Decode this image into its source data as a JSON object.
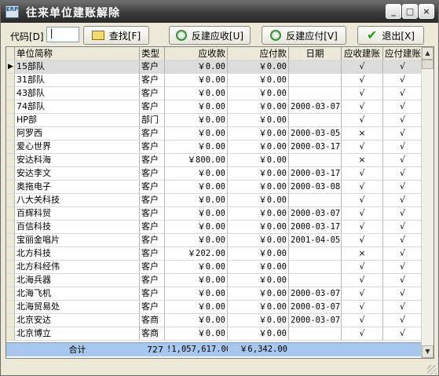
{
  "window": {
    "icon_text": "ERP",
    "title": "往来单位建账解除",
    "minimize_label": "_",
    "maximize_label": "□",
    "close_label": "×"
  },
  "toolbar": {
    "code_label": "代码[D]",
    "code_value": "|",
    "find_label": "查找[F]",
    "reverse_receivable_label": "反建应收[U]",
    "reverse_payable_label": "反建应付[V]",
    "exit_label": "退出[X]"
  },
  "table": {
    "headers": {
      "name": "单位简称",
      "type": "类型",
      "receivable": "应收款",
      "payable": "应付款",
      "date": "日期",
      "recv_created": "应收建账",
      "pay_created": "应付建账"
    },
    "rows": [
      {
        "name": "15部队",
        "type": "客户",
        "receivable": "￥0.00",
        "payable": "￥0.00",
        "date": "",
        "rc": "√",
        "pc": "√"
      },
      {
        "name": "31部队",
        "type": "客户",
        "receivable": "￥0.00",
        "payable": "￥0.00",
        "date": "",
        "rc": "√",
        "pc": "√"
      },
      {
        "name": "43部队",
        "type": "客户",
        "receivable": "￥0.00",
        "payable": "￥0.00",
        "date": "",
        "rc": "√",
        "pc": "√"
      },
      {
        "name": "74部队",
        "type": "客户",
        "receivable": "￥0.00",
        "payable": "￥0.00",
        "date": "2000-03-07",
        "rc": "√",
        "pc": "√"
      },
      {
        "name": "HP部",
        "type": "部门",
        "receivable": "￥0.00",
        "payable": "￥0.00",
        "date": "",
        "rc": "√",
        "pc": "√"
      },
      {
        "name": "阿罗西",
        "type": "客户",
        "receivable": "￥0.00",
        "payable": "￥0.00",
        "date": "2000-03-05",
        "rc": "×",
        "pc": "√"
      },
      {
        "name": "爱心世界",
        "type": "客户",
        "receivable": "￥0.00",
        "payable": "￥0.00",
        "date": "2000-03-17",
        "rc": "√",
        "pc": "√"
      },
      {
        "name": "安达科海",
        "type": "客户",
        "receivable": "￥800.00",
        "payable": "￥0.00",
        "date": "",
        "rc": "×",
        "pc": "√"
      },
      {
        "name": "安达李文",
        "type": "客户",
        "receivable": "￥0.00",
        "payable": "￥0.00",
        "date": "2000-03-17",
        "rc": "√",
        "pc": "√"
      },
      {
        "name": "奥拖电子",
        "type": "客户",
        "receivable": "￥0.00",
        "payable": "￥0.00",
        "date": "2000-03-08",
        "rc": "√",
        "pc": "√"
      },
      {
        "name": "八大关科技",
        "type": "客户",
        "receivable": "￥0.00",
        "payable": "￥0.00",
        "date": "",
        "rc": "√",
        "pc": "√"
      },
      {
        "name": "百辉科贸",
        "type": "客户",
        "receivable": "￥0.00",
        "payable": "￥0.00",
        "date": "2000-03-07",
        "rc": "√",
        "pc": "√"
      },
      {
        "name": "百信科技",
        "type": "客户",
        "receivable": "￥0.00",
        "payable": "￥0.00",
        "date": "2000-03-17",
        "rc": "√",
        "pc": "√"
      },
      {
        "name": "宝丽金唱片",
        "type": "客户",
        "receivable": "￥0.00",
        "payable": "￥0.00",
        "date": "2001-04-05",
        "rc": "√",
        "pc": "√"
      },
      {
        "name": "北方科技",
        "type": "客户",
        "receivable": "￥202.00",
        "payable": "￥0.00",
        "date": "",
        "rc": "×",
        "pc": "√"
      },
      {
        "name": "北方科经伟",
        "type": "客户",
        "receivable": "￥0.00",
        "payable": "￥0.00",
        "date": "",
        "rc": "√",
        "pc": "√"
      },
      {
        "name": "北海兵器",
        "type": "客户",
        "receivable": "￥0.00",
        "payable": "￥0.00",
        "date": "",
        "rc": "√",
        "pc": "√"
      },
      {
        "name": "北海飞机",
        "type": "客户",
        "receivable": "￥0.00",
        "payable": "￥0.00",
        "date": "2000-03-07",
        "rc": "√",
        "pc": "√"
      },
      {
        "name": "北海贸易处",
        "type": "客户",
        "receivable": "￥0.00",
        "payable": "￥0.00",
        "date": "2000-03-07",
        "rc": "√",
        "pc": "√"
      },
      {
        "name": "北京安达",
        "type": "客商",
        "receivable": "￥0.00",
        "payable": "￥0.00",
        "date": "2000-03-07",
        "rc": "√",
        "pc": "√"
      },
      {
        "name": "北京博立",
        "type": "客商",
        "receivable": "￥0.00",
        "payable": "￥0.00",
        "date": "",
        "rc": "√",
        "pc": "√"
      }
    ],
    "total": {
      "label": "合计",
      "count": "727",
      "receivable": "!1,057,617.00",
      "payable": "￥6,342.00"
    },
    "current_row_indicator": "▶"
  },
  "scrollbar": {
    "up_glyph": "▲",
    "down_glyph": "▼"
  }
}
